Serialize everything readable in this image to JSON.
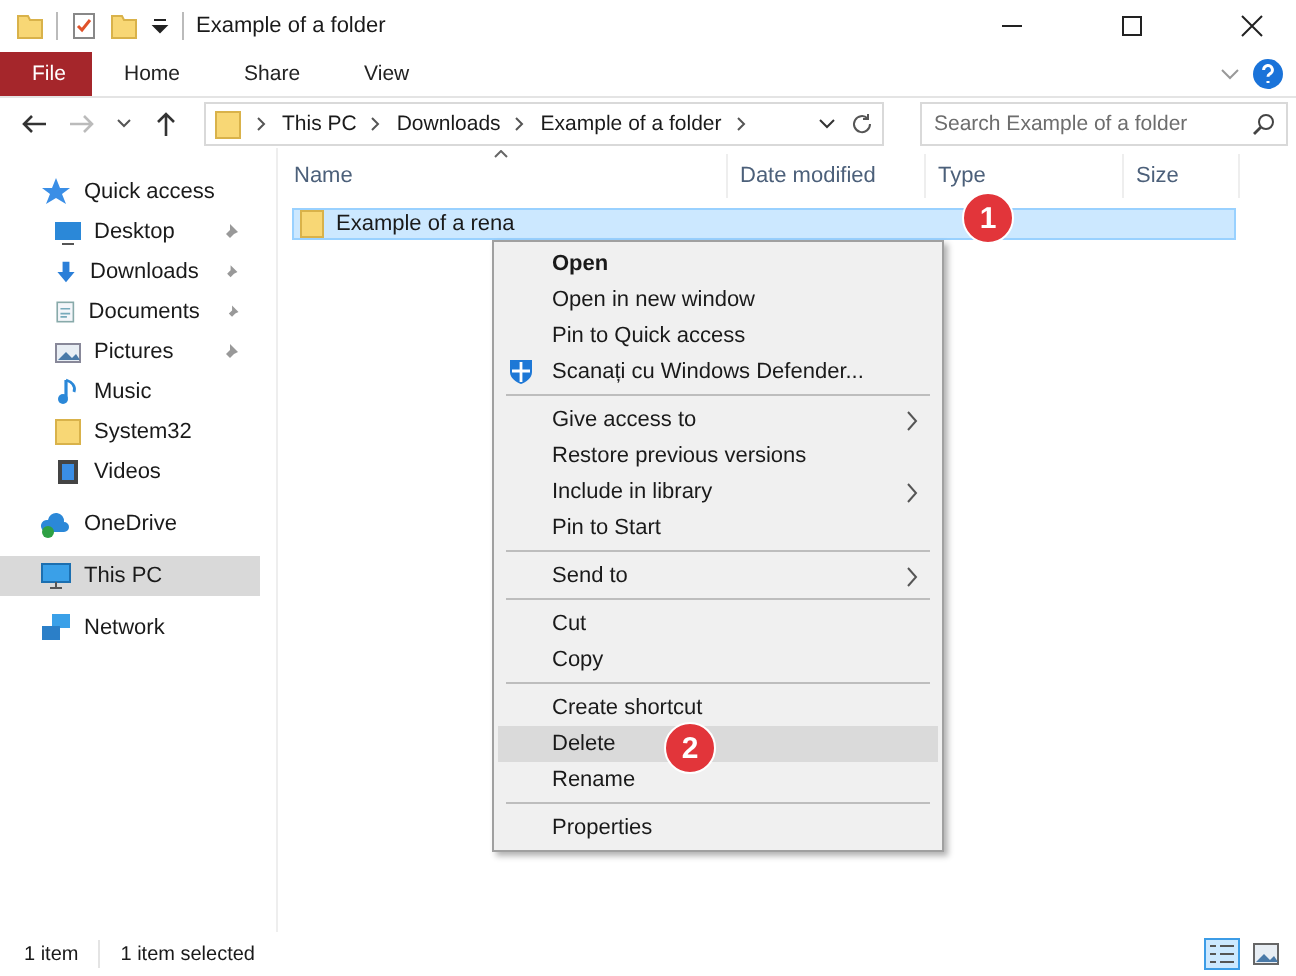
{
  "window": {
    "title": "Example of a folder"
  },
  "ribbon_tabs": [
    {
      "label": "File",
      "selected": true
    },
    {
      "label": "Home",
      "selected": false
    },
    {
      "label": "Share",
      "selected": false
    },
    {
      "label": "View",
      "selected": false
    }
  ],
  "address": {
    "segments": [
      "This PC",
      "Downloads",
      "Example of a folder"
    ]
  },
  "search": {
    "placeholder": "Search Example of a folder"
  },
  "sidebar": {
    "items": [
      {
        "label": "Quick access",
        "selected": false,
        "children": [
          {
            "label": "Desktop",
            "pinned": true
          },
          {
            "label": "Downloads",
            "pinned": true
          },
          {
            "label": "Documents",
            "pinned": true
          },
          {
            "label": "Pictures",
            "pinned": true
          },
          {
            "label": "Music",
            "pinned": false
          },
          {
            "label": "System32",
            "pinned": false
          },
          {
            "label": "Videos",
            "pinned": false
          }
        ]
      },
      {
        "label": "OneDrive",
        "selected": false
      },
      {
        "label": "This PC",
        "selected": true
      },
      {
        "label": "Network",
        "selected": false
      }
    ]
  },
  "table": {
    "columns": [
      "Name",
      "Date modified",
      "Type",
      "Size"
    ],
    "rows": [
      {
        "name": "Example of a rena",
        "selected": true
      }
    ]
  },
  "context_menu": {
    "items": [
      {
        "kind": "item",
        "label": "Open",
        "bold": true,
        "submenu": false,
        "selected": false
      },
      {
        "kind": "item",
        "label": "Open in new window",
        "bold": false,
        "submenu": false,
        "selected": false
      },
      {
        "kind": "item",
        "label": "Pin to Quick access",
        "bold": false,
        "submenu": false,
        "selected": false
      },
      {
        "kind": "item",
        "label": "Scanați cu Windows Defender...",
        "bold": false,
        "submenu": false,
        "selected": false,
        "icon": true
      },
      {
        "kind": "separator"
      },
      {
        "kind": "item",
        "label": "Give access to",
        "bold": false,
        "submenu": true,
        "selected": false
      },
      {
        "kind": "item",
        "label": "Restore previous versions",
        "bold": false,
        "submenu": false,
        "selected": false
      },
      {
        "kind": "item",
        "label": "Include in library",
        "bold": false,
        "submenu": true,
        "selected": false
      },
      {
        "kind": "item",
        "label": "Pin to Start",
        "bold": false,
        "submenu": false,
        "selected": false
      },
      {
        "kind": "separator"
      },
      {
        "kind": "item",
        "label": "Send to",
        "bold": false,
        "submenu": true,
        "selected": false
      },
      {
        "kind": "separator"
      },
      {
        "kind": "item",
        "label": "Cut",
        "bold": false,
        "submenu": false,
        "selected": false
      },
      {
        "kind": "item",
        "label": "Copy",
        "bold": false,
        "submenu": false,
        "selected": false
      },
      {
        "kind": "separator"
      },
      {
        "kind": "item",
        "label": "Create shortcut",
        "bold": false,
        "submenu": false,
        "selected": false
      },
      {
        "kind": "item",
        "label": "Delete",
        "bold": false,
        "submenu": false,
        "selected": true
      },
      {
        "kind": "item",
        "label": "Rename",
        "bold": false,
        "submenu": false,
        "selected": false
      },
      {
        "kind": "separator"
      },
      {
        "kind": "item",
        "label": "Properties",
        "bold": false,
        "submenu": false,
        "selected": false
      }
    ]
  },
  "step_badges": [
    "1",
    "2"
  ],
  "status_bar": {
    "count": "1 item",
    "selection": "1 item selected"
  }
}
